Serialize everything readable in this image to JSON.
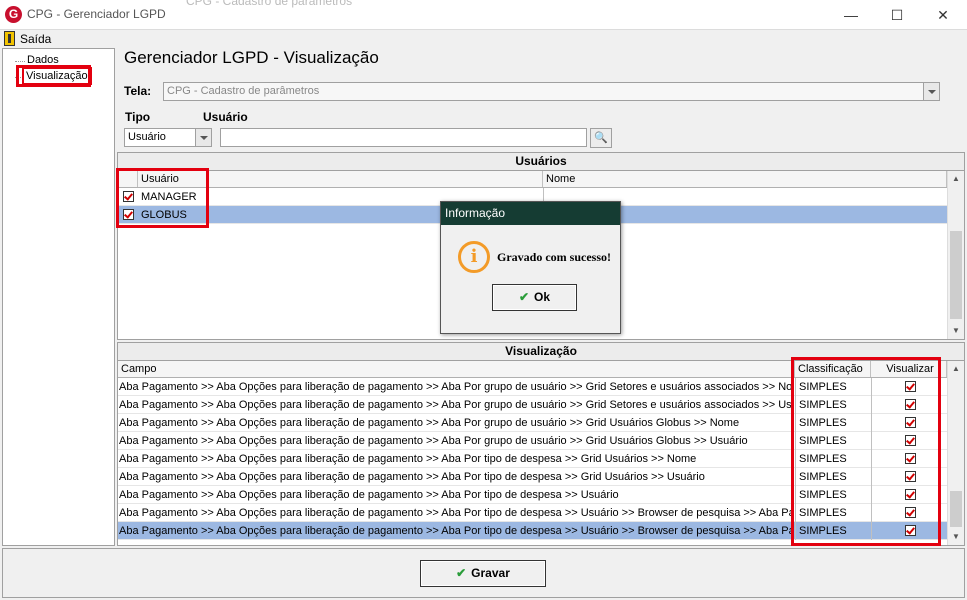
{
  "window": {
    "title": "CPG - Gerenciador LGPD",
    "background_title": "CPG - Cadastro de parâmetros",
    "minimize": "—",
    "maximize": "☐",
    "close": "✕",
    "app_icon_letter": "G"
  },
  "menu": {
    "exit_label": "Saída"
  },
  "tree": {
    "items": [
      "Dados",
      "Visualização"
    ],
    "selected": "Visualização"
  },
  "main": {
    "title": "Gerenciador LGPD - Visualização",
    "tela_label": "Tela:",
    "tela_value": "CPG - Cadastro de parâmetros",
    "tipo_label": "Tipo",
    "usuario_label": "Usuário",
    "tipo_value": "Usuário",
    "usuario_value": ""
  },
  "users_panel": {
    "title": "Usuários",
    "columns": [
      "Usuário",
      "Nome"
    ],
    "rows": [
      {
        "checked": true,
        "user": "MANAGER",
        "name": ""
      },
      {
        "checked": true,
        "user": "GLOBUS",
        "name": ""
      }
    ]
  },
  "vis_panel": {
    "title": "Visualização",
    "columns": [
      "Campo",
      "Classificação",
      "Visualizar"
    ],
    "rows": [
      {
        "campo": "Aba Pagamento >> Aba Opções para liberação de pagamento >> Aba Por grupo de usuário >> Grid Setores e usuários associados >> Nome",
        "class": "SIMPLES",
        "checked": true
      },
      {
        "campo": "Aba Pagamento >> Aba Opções para liberação de pagamento >> Aba Por grupo de usuário >> Grid Setores e usuários associados >> Usuário",
        "class": "SIMPLES",
        "checked": true
      },
      {
        "campo": "Aba Pagamento >> Aba Opções para liberação de pagamento >> Aba Por grupo de usuário >> Grid Usuários Globus >> Nome",
        "class": "SIMPLES",
        "checked": true
      },
      {
        "campo": "Aba Pagamento >> Aba Opções para liberação de pagamento >> Aba Por grupo de usuário >> Grid Usuários Globus >> Usuário",
        "class": "SIMPLES",
        "checked": true
      },
      {
        "campo": "Aba Pagamento >> Aba Opções para liberação de pagamento >> Aba Por tipo de despesa >> Grid Usuários >> Nome",
        "class": "SIMPLES",
        "checked": true
      },
      {
        "campo": "Aba Pagamento >> Aba Opções para liberação de pagamento >> Aba Por tipo de despesa >> Grid Usuários >> Usuário",
        "class": "SIMPLES",
        "checked": true
      },
      {
        "campo": "Aba Pagamento >> Aba Opções para liberação de pagamento >> Aba Por tipo de despesa >> Usuário",
        "class": "SIMPLES",
        "checked": true
      },
      {
        "campo": "Aba Pagamento >> Aba Opções para liberação de pagamento >> Aba Por tipo de despesa >> Usuário >> Browser de pesquisa >> Aba Paga...",
        "class": "SIMPLES",
        "checked": true
      },
      {
        "campo": "Aba Pagamento >> Aba Opções para liberação de pagamento >> Aba Por tipo de despesa >> Usuário >> Browser de pesquisa >> Aba Paga...",
        "class": "SIMPLES",
        "checked": true
      }
    ]
  },
  "dialog": {
    "title": "Informação",
    "message": "Gravado com sucesso!",
    "ok_label": "Ok",
    "icon": "i"
  },
  "footer": {
    "save_label": "Gravar"
  },
  "colors": {
    "highlight": "#e3000f",
    "selection": "#9cb8e2",
    "dialog_title_bg": "#153c33"
  }
}
